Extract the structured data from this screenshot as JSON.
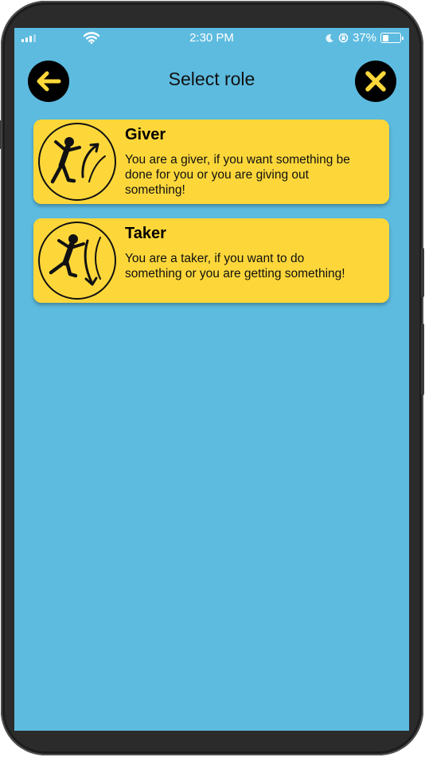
{
  "status": {
    "time": "2:30 PM",
    "battery": "37%",
    "battery_level": 0.37
  },
  "header": {
    "title": "Select role",
    "back_icon": "arrow-left-icon",
    "close_icon": "close-icon"
  },
  "roles": [
    {
      "title": "Giver",
      "description": "You are a giver, if you want something be done for you or you are giving out something!",
      "icon": "giver-icon"
    },
    {
      "title": "Taker",
      "description": "You are a taker, if you want to do something or you are getting something!",
      "icon": "taker-icon"
    }
  ],
  "colors": {
    "screen_bg": "#5dbbdf",
    "card_bg": "#fdd73a",
    "icon_accent": "#fdd73a",
    "button_bg": "#000000"
  }
}
